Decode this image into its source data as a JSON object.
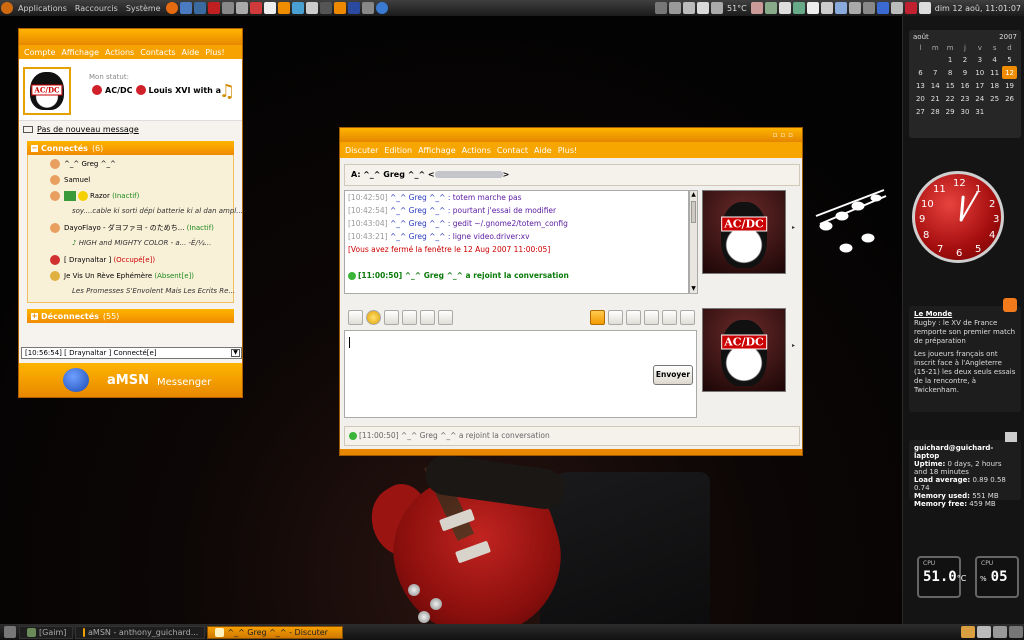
{
  "top_panel": {
    "menus": [
      "Applications",
      "Raccourcis",
      "Système"
    ],
    "temperature": "51°C",
    "datetime": "dim 12 aoû, 11:01:07"
  },
  "bottom_panel": {
    "tasks": [
      {
        "label": "[Gaim]",
        "active": false
      },
      {
        "label": "aMSN - anthony_guichard...",
        "active": false
      },
      {
        "label": "^_^ Greg ^_^ - Discuter",
        "active": true
      }
    ]
  },
  "calendar": {
    "month": "août",
    "year": "2007",
    "weekdays": [
      "l",
      "m",
      "m",
      "j",
      "v",
      "s",
      "d"
    ],
    "weeks": [
      [
        "",
        "",
        "1",
        "2",
        "3",
        "4",
        "5"
      ],
      [
        "6",
        "7",
        "8",
        "9",
        "10",
        "11",
        "12"
      ],
      [
        "13",
        "14",
        "15",
        "16",
        "17",
        "18",
        "19"
      ],
      [
        "20",
        "21",
        "22",
        "23",
        "24",
        "25",
        "26"
      ],
      [
        "27",
        "28",
        "29",
        "30",
        "31",
        "",
        ""
      ]
    ],
    "today": "12"
  },
  "clock": {
    "numbers": [
      "12",
      "1",
      "2",
      "3",
      "4",
      "5",
      "6",
      "7",
      "8",
      "9",
      "10",
      "11"
    ]
  },
  "news": {
    "source": "Le Monde",
    "item1": "Rugby : le XV de France remporte son premier match de préparation",
    "item2": "Les joueurs français ont inscrit face à l'Angleterre (15-21) les deux seuls essais de la rencontre, à Twickenham."
  },
  "sysinfo": {
    "host": "guichard@guichard-laptop",
    "uptime_label": "Uptime:",
    "uptime": "0 days, 2 hours and 18 minutes",
    "load_label": "Load average:",
    "load": "0.89 0.58 0.74",
    "memused_label": "Memory used:",
    "memused": "551 MB",
    "memfree_label": "Memory free:",
    "memfree": "459 MB"
  },
  "cpu_widgets": [
    {
      "label": "CPU",
      "value": "51.0",
      "unit": "°C"
    },
    {
      "label": "CPU",
      "value": "05",
      "unit": "%"
    }
  ],
  "contact_window": {
    "menu": [
      "Compte",
      "Affichage",
      "Actions",
      "Contacts",
      "Aide",
      "Plus!"
    ],
    "status_label": "Mon statut:",
    "status_text": "AC/DC",
    "status_extra": "Louis XVI with a",
    "no_mail": "Pas de nouveau message",
    "online_group": "Connectés",
    "online_count": "(6)",
    "offline_group": "Déconnectés",
    "offline_count": "(55)",
    "contacts": [
      {
        "name": "^_^ Greg ^_^",
        "state": "",
        "psm": ""
      },
      {
        "name": "Samuel",
        "state": "",
        "psm": ""
      },
      {
        "name": "Razor",
        "state": "(Inactif)",
        "psm": "soy....cable ki sorti dépi batterie ki al dan ampl..."
      },
      {
        "name": "DayoFlayo - ダヨファヨ - のためち...",
        "state": "(Inactif)",
        "psm": "HIGH and MIGHTY COLOR - a... -É/¼..."
      },
      {
        "name": "[ Draynaltar ]",
        "state": "(Occupé[e])",
        "psm": ""
      },
      {
        "name": "Je Vis Un Rève Ephémère",
        "state": "(Absent[e])",
        "psm": "Les Promesses S'Envolent Mais Les Ecrits Re..."
      }
    ],
    "statusbar": "[10:56:54] [ Draynaltar ] Connecté[e]",
    "footer_brand": "aMSN",
    "footer_sub": "Messenger"
  },
  "chat_window": {
    "menu": [
      "Discuter",
      "Edition",
      "Affichage",
      "Actions",
      "Contact",
      "Aide",
      "Plus!"
    ],
    "to_label": "A:",
    "to_name": "^_^ Greg ^_^ <",
    "to_end": ">",
    "history": [
      {
        "ts": "[10:42:50]",
        "nick": "^_^ Greg ^_^ :",
        "msg": "totem marche pas"
      },
      {
        "ts": "[10:42:54]",
        "nick": "^_^ Greg ^_^ :",
        "msg": "pourtant j'essai de modifier"
      },
      {
        "ts": "[10:43:04]",
        "nick": "^_^ Greg ^_^ :",
        "msg": " gedit ~/.gnome2/totem_config"
      },
      {
        "ts": "[10:43:21]",
        "nick": "^_^ Greg ^_^ :",
        "msg": "ligne video.driver:xv"
      }
    ],
    "closed_notice": "[Vous avez fermé la fenêtre le 12 Aug 2007 11:00:05]",
    "join_notice": "[11:00:50] ^_^ Greg ^_^ a rejoint la conversation",
    "send_label": "Envoyer",
    "status_bar": "[11:00:50] ^_^ Greg ^_^ a rejoint la conversation",
    "avatar_text": "AC/DC"
  }
}
